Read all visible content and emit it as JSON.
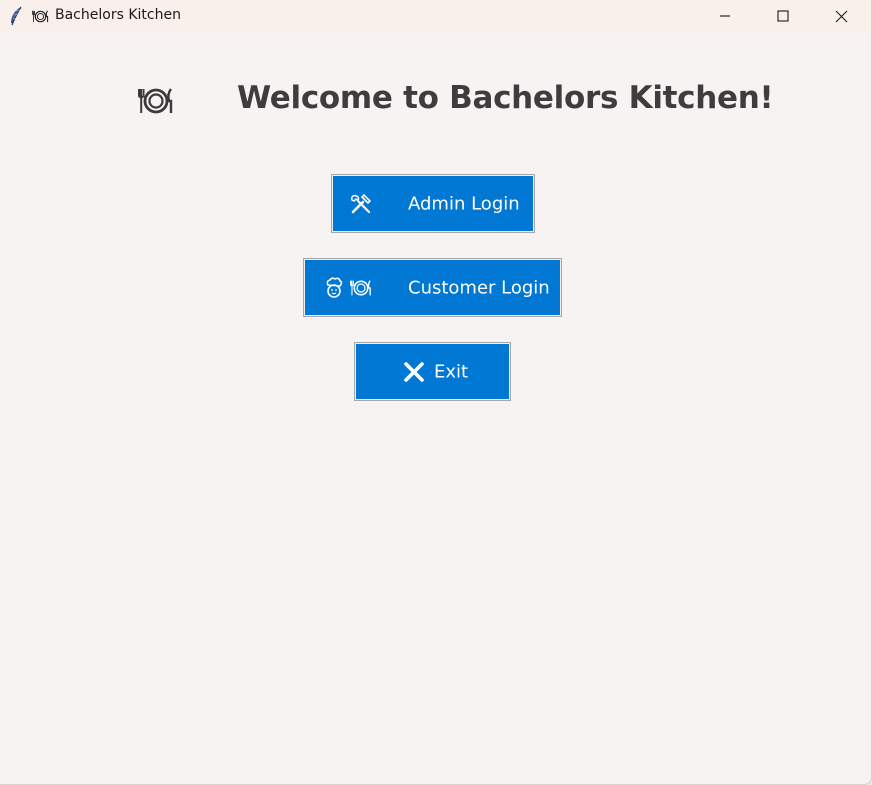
{
  "window": {
    "title": "Bachelors Kitchen",
    "app_icon": "feather-icon",
    "title_icon": "plate-cutlery-icon",
    "controls": {
      "minimize_icon": "minimize-icon",
      "maximize_icon": "maximize-icon",
      "close_icon": "close-icon"
    }
  },
  "main": {
    "heading_icon": "plate-cutlery-icon",
    "heading": "Welcome to Bachelors Kitchen!",
    "buttons": [
      {
        "label": "Admin Login",
        "icons": [
          "tools-icon"
        ]
      },
      {
        "label": "Customer Login",
        "icons": [
          "cook-icon",
          "plate-cutlery-icon"
        ]
      },
      {
        "label": "Exit",
        "icons": [
          "cross-mark-icon"
        ]
      }
    ]
  },
  "colors": {
    "window_background": "#f7f3f2",
    "titlebar_background": "#f9efeb",
    "button_background": "#0078d4",
    "button_text": "#ffffff",
    "heading_text": "#3d3d3d"
  }
}
